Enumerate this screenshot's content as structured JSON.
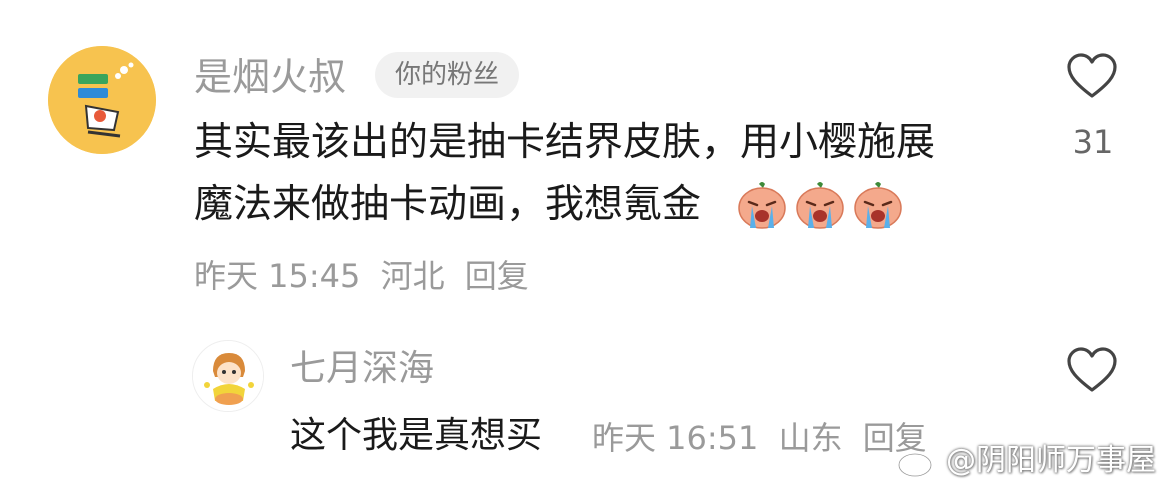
{
  "comment": {
    "username": "是烟火叔",
    "badge": "你的粉丝",
    "text_line1": "其实最该出的是抽卡结界皮肤，用小樱施展",
    "text_line2": "魔法来做抽卡动画，我想氪金",
    "emojis": [
      "crying-face-icon",
      "crying-face-icon",
      "crying-face-icon"
    ],
    "time": "昨天 15:45",
    "location": "河北",
    "reply_label": "回复",
    "like_count": "31"
  },
  "reply": {
    "username": "七月深海",
    "text": "这个我是真想买",
    "time": "昨天 16:51",
    "location": "山东",
    "reply_label": "回复"
  },
  "watermark": {
    "text": "@阴阳师万事屋",
    "icon": "weibo-logo-icon"
  },
  "colors": {
    "text_primary": "#1a1a1a",
    "text_secondary": "#9a9a9a",
    "badge_bg": "#f1f1f1",
    "avatar_bg": "#f7c34f"
  }
}
